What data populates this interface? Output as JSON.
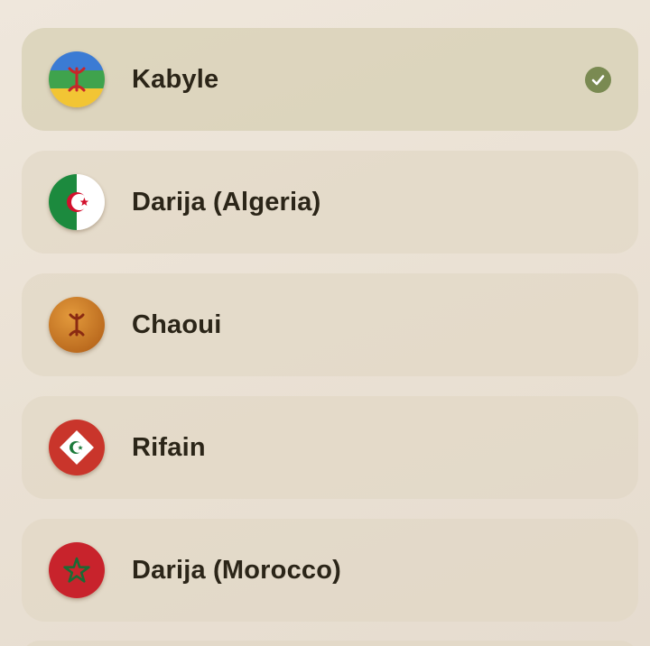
{
  "languages": [
    {
      "label": "Kabyle",
      "flag_icon": "amazigh-flag-icon",
      "selected": true
    },
    {
      "label": "Darija (Algeria)",
      "flag_icon": "algeria-flag-icon",
      "selected": false
    },
    {
      "label": "Chaoui",
      "flag_icon": "chaoui-flag-icon",
      "selected": false
    },
    {
      "label": "Rifain",
      "flag_icon": "rif-flag-icon",
      "selected": false
    },
    {
      "label": "Darija (Morocco)",
      "flag_icon": "morocco-flag-icon",
      "selected": false
    }
  ],
  "colors": {
    "check_accent": "#7a8a52",
    "text": "#2b2518"
  }
}
